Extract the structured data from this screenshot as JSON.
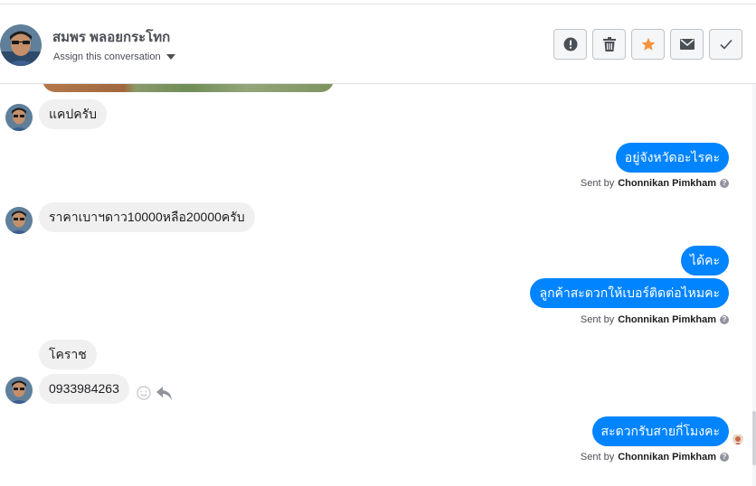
{
  "header": {
    "contact_name": "สมพร พลอยกระโทก",
    "assign_label": "Assign this conversation"
  },
  "actions": [
    {
      "icon": "exclamation-icon",
      "label": "Mark as spam"
    },
    {
      "icon": "trash-icon",
      "label": "Delete"
    },
    {
      "icon": "star-icon",
      "label": "Star",
      "color": "#f7923a"
    },
    {
      "icon": "envelope-icon",
      "label": "Mark as unread"
    },
    {
      "icon": "checkmark-icon",
      "label": "Mark as done"
    }
  ],
  "messages": [
    {
      "from": "customer",
      "text": "แคปครับ"
    },
    {
      "from": "page",
      "text": "อยู่จังหวัดอะไรคะ",
      "sent_by_prefix": "Sent by",
      "sent_by": "Chonnikan Pimkham"
    },
    {
      "from": "customer",
      "text": "ราคาเบาฯดาว10000หลือ20000ครับ"
    },
    {
      "from": "page",
      "text": "ได้คะ"
    },
    {
      "from": "page",
      "text": "ลูกค้าสะดวกให้เบอร์ติดต่อไหมคะ",
      "sent_by_prefix": "Sent by",
      "sent_by": "Chonnikan Pimkham"
    },
    {
      "from": "customer",
      "text": "โคราช"
    },
    {
      "from": "customer",
      "text": "0933984263"
    },
    {
      "from": "page",
      "text": "สะดวกรับสายกี่โมงคะ",
      "sent_by_prefix": "Sent by",
      "sent_by": "Chonnikan Pimkham"
    }
  ],
  "colors": {
    "outgoing_bubble": "#0084ff",
    "incoming_bubble": "#f1f0f0",
    "star": "#f7923a"
  }
}
